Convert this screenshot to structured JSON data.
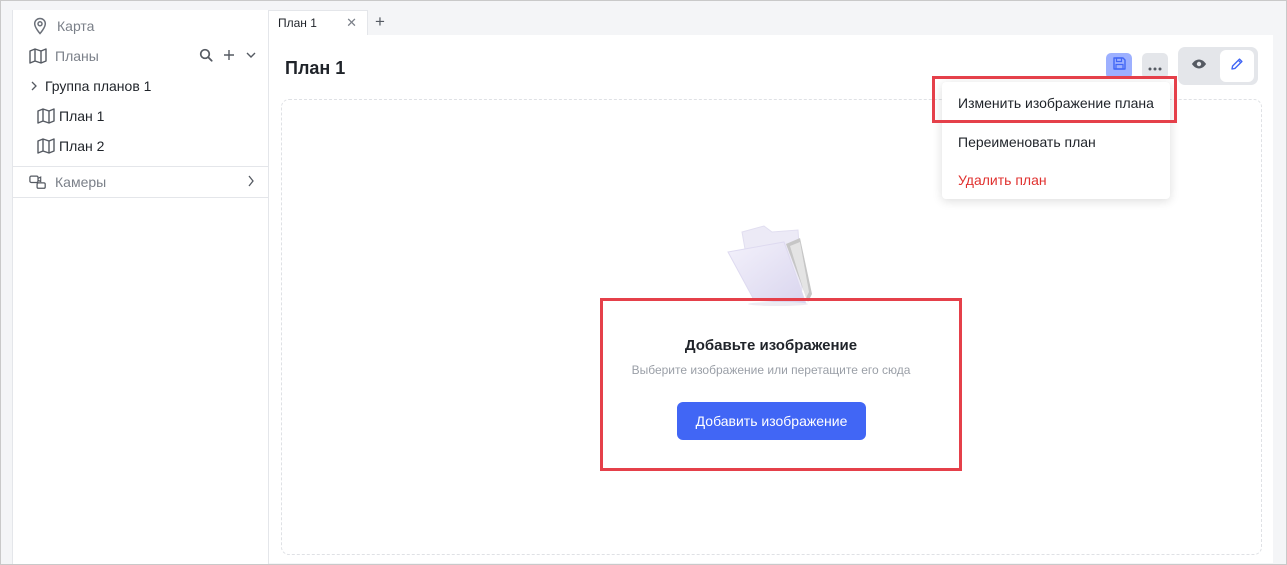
{
  "sidebar": {
    "items": [
      {
        "label": "Карта",
        "icon": "map-pin-icon"
      },
      {
        "label": "Планы",
        "icon": "map-icon"
      },
      {
        "label": "Группа планов 1",
        "icon": "chevron-right-icon"
      },
      {
        "label": "План 1",
        "icon": "map-icon"
      },
      {
        "label": "План 2",
        "icon": "map-icon"
      },
      {
        "label": "Камеры",
        "icon": "camera-icon"
      }
    ]
  },
  "tabs": [
    {
      "label": "План 1",
      "active": true
    }
  ],
  "main": {
    "title": "План 1",
    "empty_title": "Добавьте изображение",
    "empty_subtitle": "Выберите изображение или перетащите его сюда",
    "add_button": "Добавить изображение"
  },
  "menu": {
    "items": [
      {
        "label": "Изменить изображение плана"
      },
      {
        "label": "Переименовать план"
      },
      {
        "label": "Удалить план",
        "danger": true
      }
    ]
  },
  "colors": {
    "accent": "#4166f5",
    "highlight": "#e5404a",
    "danger": "#e0312f"
  }
}
